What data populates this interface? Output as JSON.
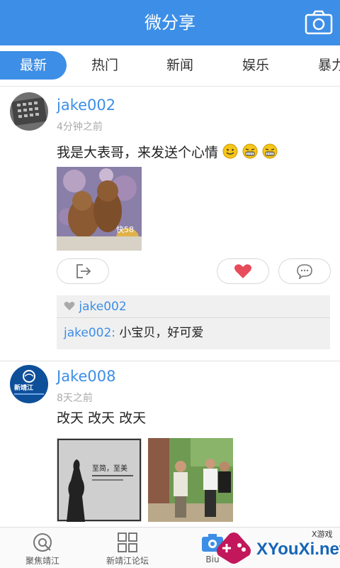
{
  "header": {
    "title": "微分享",
    "camera_icon": "camera-icon"
  },
  "tabs": [
    {
      "label": "最新",
      "active": true
    },
    {
      "label": "热门",
      "active": false
    },
    {
      "label": "新闻",
      "active": false
    },
    {
      "label": "娱乐",
      "active": false
    },
    {
      "label": "暴力",
      "active": false
    }
  ],
  "posts": [
    {
      "username": "jake002",
      "time": "4分钟之前",
      "text": "我是大表哥，来发送个心情",
      "emojis": [
        "smile-emoji",
        "grin-emoji",
        "grin-emoji"
      ],
      "photo_text": "快58",
      "likes": {
        "user": "jake002"
      },
      "comments": [
        {
          "user": "jake002:",
          "text": "小宝贝，好可爱"
        }
      ]
    },
    {
      "username": "Jake008",
      "time": "8天之前",
      "text": "改天 改天 改天",
      "avatar_text": "新靖江",
      "photo1_text": "至简，至美"
    }
  ],
  "bottom_nav": [
    {
      "label": "聚焦靖江",
      "icon": "focus-icon"
    },
    {
      "label": "新靖江论坛",
      "icon": "grid-icon"
    },
    {
      "label": "Biu",
      "icon": "camera-icon"
    }
  ],
  "watermark": {
    "text": "XYouXi.net",
    "small": "X游戏"
  },
  "colors": {
    "accent": "#3d8ee6",
    "like": "#e84b5a"
  }
}
